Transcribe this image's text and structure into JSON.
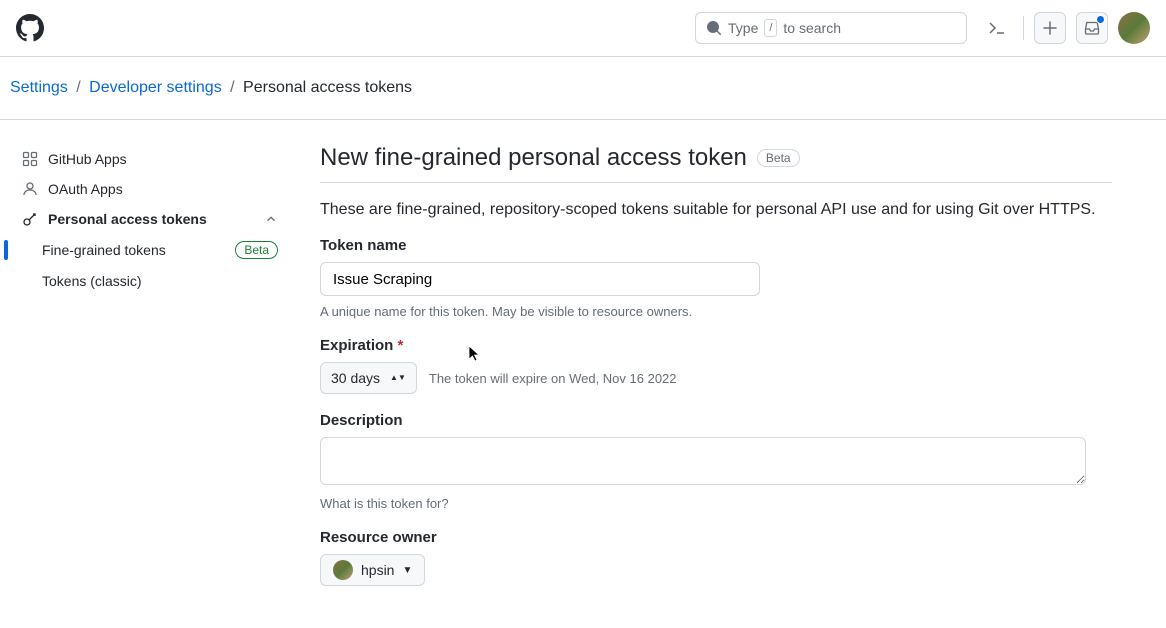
{
  "header": {
    "search_placeholder_prefix": "Type",
    "search_placeholder_suffix": "to search",
    "slash_key": "/"
  },
  "breadcrumb": {
    "a": "Settings",
    "b": "Developer settings",
    "c": "Personal access tokens"
  },
  "sidebar": {
    "github_apps": "GitHub Apps",
    "oauth_apps": "OAuth Apps",
    "pat": "Personal access tokens",
    "fine_grained": "Fine-grained tokens",
    "fine_grained_badge": "Beta",
    "classic": "Tokens (classic)"
  },
  "page": {
    "title": "New fine-grained personal access token",
    "title_badge": "Beta",
    "intro": "These are fine-grained, repository-scoped tokens suitable for personal API use and for using Git over HTTPS."
  },
  "form": {
    "token_name_label": "Token name",
    "token_name_value": "Issue Scraping",
    "token_name_help": "A unique name for this token. May be visible to resource owners.",
    "expiration_label": "Expiration",
    "expiration_value": "30 days",
    "expiration_note": "The token will expire on Wed, Nov 16 2022",
    "description_label": "Description",
    "description_value": "",
    "description_help": "What is this token for?",
    "resource_owner_label": "Resource owner",
    "resource_owner_value": "hpsin"
  }
}
